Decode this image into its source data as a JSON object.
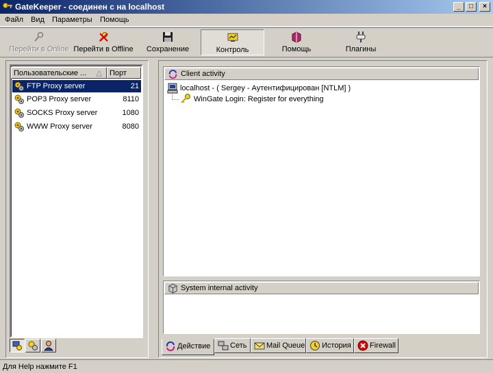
{
  "window": {
    "title": "GateKeeper - соединен с на localhost"
  },
  "menu": [
    "Файл",
    "Вид",
    "Параметры",
    "Помощь"
  ],
  "toolbar": {
    "go_online": "Перейти в Online",
    "go_offline": "Перейти в Offline",
    "save": "Сохранение",
    "control": "Контроль",
    "help": "Помощь",
    "plugins": "Плагины"
  },
  "services": {
    "col_name": "Пользовательские ...",
    "col_port": "Порт",
    "rows": [
      {
        "name": "FTP Proxy server",
        "port": "21",
        "selected": true
      },
      {
        "name": "POP3 Proxy server",
        "port": "8110",
        "selected": false
      },
      {
        "name": "SOCKS Proxy server",
        "port": "1080",
        "selected": false
      },
      {
        "name": "WWW Proxy server",
        "port": "8080",
        "selected": false
      }
    ]
  },
  "activity": {
    "title": "Client activity",
    "client": "localhost  -  ( Sergey  -  Аутентифицирован [NTLM] )",
    "login": "WinGate Login: Register for everything"
  },
  "system": {
    "title": "System internal activity"
  },
  "tabs": [
    "Действие",
    "Сеть",
    "Mail Queue",
    "История",
    "Firewall"
  ],
  "status": "Для Help нажмите F1",
  "colors": {
    "titlebar": "#0a246a",
    "selection": "#0a246a",
    "face": "#d4d0c8"
  }
}
